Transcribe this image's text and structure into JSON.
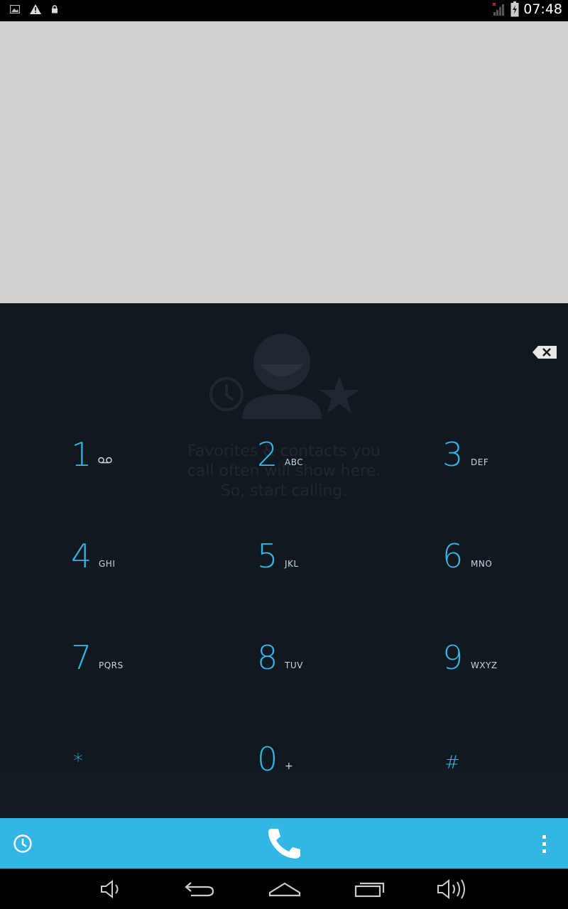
{
  "status_bar": {
    "time": "07:48",
    "left_icons": [
      "image-notification-icon",
      "warning-icon",
      "lock-icon"
    ],
    "right_icons": [
      "signal-no-service-icon",
      "battery-charging-icon"
    ]
  },
  "empty_state": {
    "message_line1": "Favorites & contacts you",
    "message_line2": "call often will show here.",
    "message_line3": "So, start calling."
  },
  "dialpad": {
    "keys": [
      {
        "digit": "1",
        "letters": "",
        "icon": "voicemail-icon"
      },
      {
        "digit": "2",
        "letters": "ABC"
      },
      {
        "digit": "3",
        "letters": "DEF"
      },
      {
        "digit": "4",
        "letters": "GHI"
      },
      {
        "digit": "5",
        "letters": "JKL"
      },
      {
        "digit": "6",
        "letters": "MNO"
      },
      {
        "digit": "7",
        "letters": "PQRS"
      },
      {
        "digit": "8",
        "letters": "TUV"
      },
      {
        "digit": "9",
        "letters": "WXYZ"
      },
      {
        "digit": "*",
        "letters": ""
      },
      {
        "digit": "0",
        "letters": "+"
      },
      {
        "digit": "#",
        "letters": ""
      }
    ]
  },
  "colors": {
    "accent": "#33b5e5",
    "dialpad_bg": "#111920",
    "top_area_bg": "#d0d0d0"
  },
  "action_bar": {
    "left_icon": "call-history-icon",
    "center_icon": "phone-call-icon",
    "right_icon": "overflow-menu-icon"
  },
  "nav_bar": {
    "icons": [
      "volume-down-icon",
      "back-icon",
      "home-icon",
      "recent-apps-icon",
      "volume-up-icon"
    ]
  }
}
